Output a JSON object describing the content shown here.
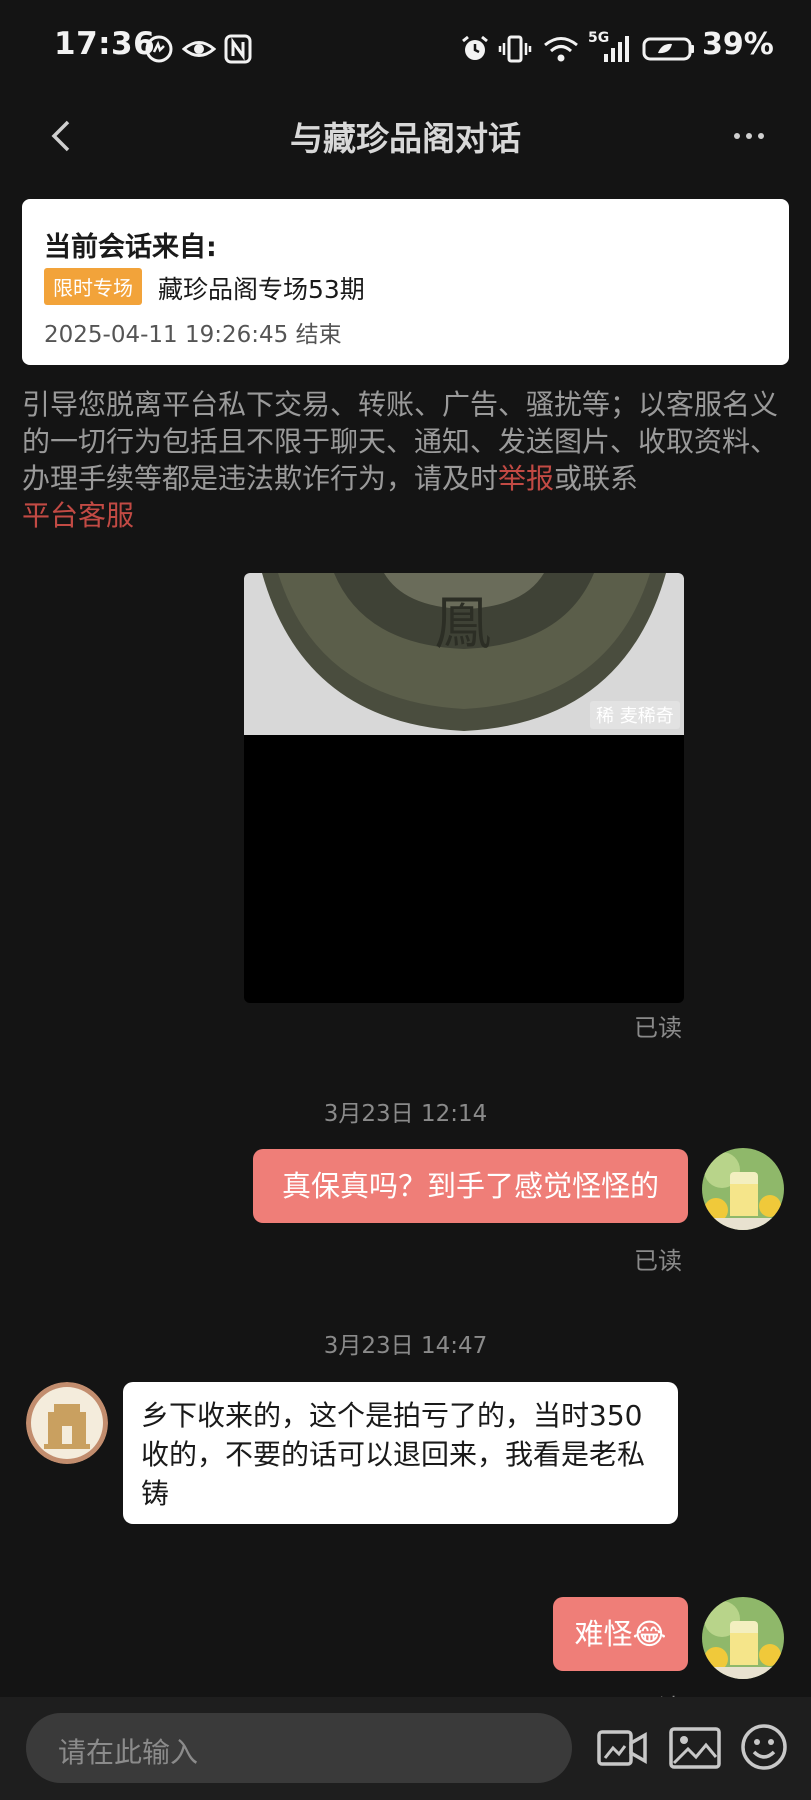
{
  "status_bar": {
    "time": "17:36",
    "battery": "39%",
    "network": "5G",
    "icons": [
      "smart-assistant-icon",
      "eye-icon",
      "nfc-icon",
      "alarm-icon",
      "vibrate-icon",
      "wifi-icon",
      "signal-icon",
      "battery-icon"
    ]
  },
  "header": {
    "title": "与藏珍品阁对话",
    "back_icon": "chevron-left-icon",
    "more_icon": "more-horizontal-icon"
  },
  "session_card": {
    "title": "当前会话来自:",
    "tag": "限时专场",
    "name": "藏珍品阁专场53期",
    "date": "2025-04-11 19:26:45 结束",
    "tag_color": "#f2a33a"
  },
  "warning": {
    "text": "引导您脱离平台私下交易、转账、广告、骚扰等；以客服名义的一切行为包括且不限于聊天、通知、发送图片、收取资料、办理手续等都是违法欺诈行为，请及时",
    "link_report": "举报",
    "middle": "或联系",
    "link_service": "平台客服",
    "link_color": "#c24a44"
  },
  "messages": {
    "image_watermark": "稀 麦稀奇",
    "image_coin_char": "鳯",
    "image_read": "已读",
    "ts1": "3月23日 12:14",
    "msg1": "真保真吗？到手了感觉怪怪的",
    "msg1_read": "已读",
    "ts2": "3月23日 14:47",
    "msg2": "乡下收来的，这个是拍亏了的，当时350收的，不要的话可以退回来，我看是老私铸",
    "msg3": "难怪😂",
    "msg3_read": "已读",
    "outgoing_color": "#ef7e78"
  },
  "input_bar": {
    "placeholder": "请在此输入",
    "icons": [
      "video-camera-icon",
      "image-icon",
      "emoji-icon"
    ]
  }
}
